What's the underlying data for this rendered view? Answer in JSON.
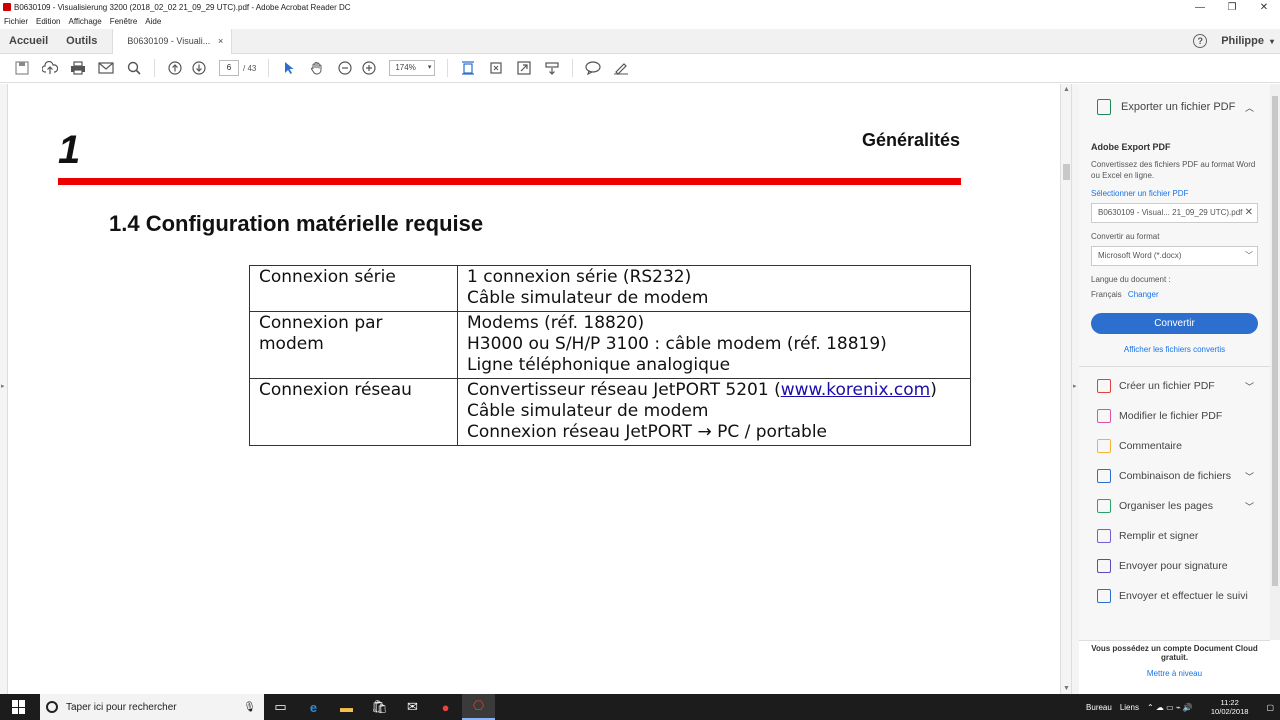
{
  "window": {
    "title": "B0630109 - Visualisierung 3200 (2018_02_02 21_09_29 UTC).pdf - Adobe Acrobat Reader DC"
  },
  "menu": [
    "Fichier",
    "Edition",
    "Affichage",
    "Fenêtre",
    "Aide"
  ],
  "tabs": {
    "home": "Accueil",
    "tools": "Outils",
    "doc": "B0630109 - Visuali...",
    "close": "×",
    "user": "Philippe"
  },
  "toolbar": {
    "page_current": "6",
    "page_total": "/ 43",
    "zoom": "174%"
  },
  "document": {
    "chapter_number": "1",
    "chapter_title": "Généralités",
    "section_title": "1.4 Configuration matérielle requise",
    "rows": [
      {
        "key": "Connexion série",
        "lines": [
          "1 connexion série (RS232)",
          "Câble simulateur de modem"
        ]
      },
      {
        "key": "Connexion par modem",
        "lines": [
          "Modems (réf. 18820)",
          "H3000 ou S/H/P 3100 : câble modem (réf. 18819)",
          "Ligne téléphonique analogique"
        ]
      },
      {
        "key": "Connexion réseau",
        "line1_prefix": "Convertisseur réseau JetPORT 5201 (",
        "line1_link": "www.korenix.com",
        "line1_suffix": ")",
        "lines": [
          "Câble simulateur de modem",
          "Connexion réseau JetPORT → PC / portable"
        ]
      }
    ]
  },
  "right_panel": {
    "export_header": "Exporter un fichier PDF",
    "export_title": "Adobe Export PDF",
    "export_desc": "Convertissez des fichiers PDF au format Word ou Excel en ligne.",
    "select_link": "Sélectionner un fichier PDF",
    "selected_file": "B0630109 - Visual... 21_09_29 UTC).pdf",
    "convert_to_label": "Convertir au format",
    "format_value": "Microsoft Word (*.docx)",
    "lang_label": "Langue du document :",
    "lang_value": "Français",
    "lang_change": "Changer",
    "convert_button": "Convertir",
    "show_converted": "Afficher les fichiers convertis",
    "tools": [
      {
        "label": "Créer un fichier PDF",
        "color": "#e0413a",
        "expand": true
      },
      {
        "label": "Modifier le fichier PDF",
        "color": "#d9569c",
        "expand": false
      },
      {
        "label": "Commentaire",
        "color": "#f2b632",
        "expand": false
      },
      {
        "label": "Combinaison de fichiers",
        "color": "#2c6fcf",
        "expand": true
      },
      {
        "label": "Organiser les pages",
        "color": "#2aa36b",
        "expand": true
      },
      {
        "label": "Remplir et signer",
        "color": "#7a5bd6",
        "expand": false
      },
      {
        "label": "Envoyer pour signature",
        "color": "#5a4bb8",
        "expand": false
      },
      {
        "label": "Envoyer et effectuer le suivi",
        "color": "#2c6fcf",
        "expand": false
      }
    ],
    "footer_text": "Vous possédez un compte Document Cloud gratuit.",
    "footer_link": "Mettre à niveau"
  },
  "taskbar": {
    "search_placeholder": "Taper ici pour rechercher",
    "tray_left": "Bureau",
    "tray_links": "Liens",
    "time": "11:22",
    "date": "10/02/2018"
  }
}
